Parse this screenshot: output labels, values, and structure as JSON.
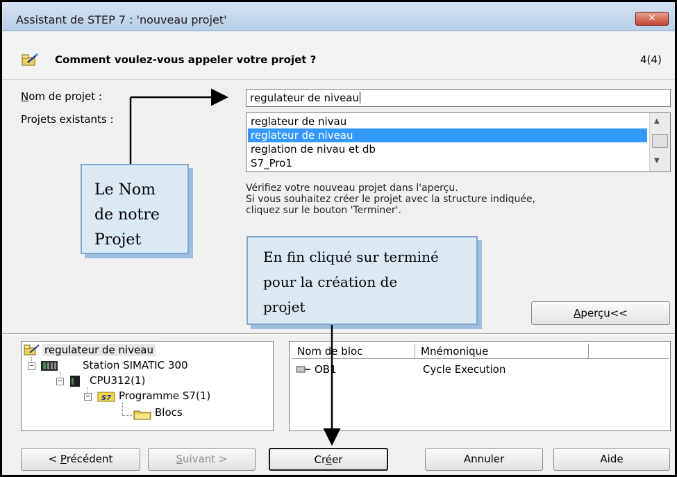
{
  "window": {
    "title": "Assistant de STEP 7 : 'nouveau projet'",
    "close_glyph": "✕"
  },
  "header": {
    "question": "Comment voulez-vous appeler votre projet ?",
    "step": "4(4)",
    "icon": "wizard-wand-icon"
  },
  "form": {
    "name_label_mnemonic": "N",
    "name_label_rest": "om de projet :",
    "name_value": "regulateur de niveau",
    "existing_label": "Projets existants :",
    "existing_projects": [
      "reglateur de nivau",
      "reglateur de niveau",
      "reglation de nivau et db",
      "S7_Pro1"
    ],
    "selected_index": 1
  },
  "info": {
    "line1": "Vérifiez votre nouveau projet dans l'aperçu.",
    "line2": "Si vous souhaitez créer le projet avec la structure  indiquée,",
    "line3": "cliquez sur le bouton 'Terminer'."
  },
  "preview_button": {
    "mnemonic": "A",
    "rest": "perçu<<"
  },
  "tree": {
    "items": [
      {
        "label": "regulateur de niveau",
        "icon": "project-icon"
      },
      {
        "label": "Station SIMATIC 300",
        "icon": "simatic-station-icon"
      },
      {
        "label": "CPU312(1)",
        "icon": "cpu-icon"
      },
      {
        "label": "Programme S7(1)",
        "icon": "s7-program-icon"
      },
      {
        "label": "Blocs",
        "icon": "folder-icon"
      }
    ]
  },
  "blocks_table": {
    "columns": [
      "Nom de bloc",
      "Mnémonique"
    ],
    "rows": [
      {
        "name": "OB1",
        "mnemonic": "Cycle Execution",
        "icon": "block-icon"
      }
    ]
  },
  "buttons": {
    "previous": {
      "pre": "< ",
      "mnemonic": "P",
      "rest": "récédent"
    },
    "next": {
      "mnemonic": "S",
      "rest": "uivant >"
    },
    "create": {
      "pre": "Cr",
      "mnemonic": "é",
      "rest": "er"
    },
    "cancel": "Annuler",
    "help": "Aide"
  },
  "annotations": {
    "callout_name": [
      "Le Nom",
      "de notre",
      "Projet"
    ],
    "callout_finish": [
      "En fin cliqué sur terminé",
      "pour la création de",
      "projet"
    ]
  },
  "colors": {
    "selection": "#3399ff",
    "callout_fill": "#dbe9f5",
    "callout_border": "#7fa7cc"
  }
}
